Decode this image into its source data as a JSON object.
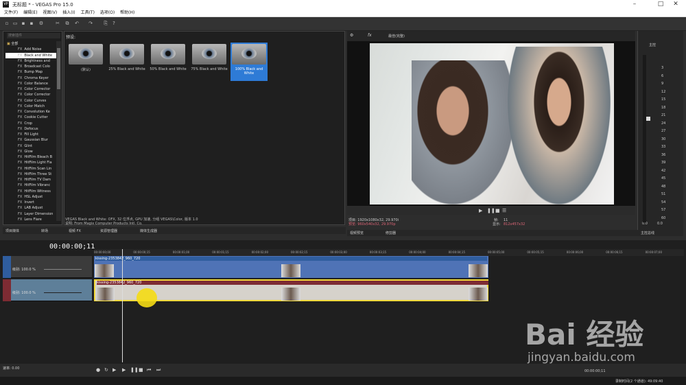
{
  "window": {
    "title": "无标题 * - VEGAS Pro 15.0",
    "app_icon": "VP"
  },
  "menu": [
    "文件(F)",
    "编辑(E)",
    "视图(V)",
    "插入(I)",
    "工具(T)",
    "选项(O)",
    "帮助(H)"
  ],
  "fx": {
    "search_placeholder": "搜索插件",
    "tree_root": "全部",
    "items": [
      "Add Noise",
      "Black and White",
      "Brightness and",
      "Broadcast Colo",
      "Bump Map",
      "Chroma Keyer",
      "Color Balance",
      "Color Corrector",
      "Color Corrector",
      "Color Curves",
      "Color Match",
      "Convolution Ke",
      "Cookie Cutter",
      "Crop",
      "Defocus",
      "Fill Light",
      "Gaussian Blur",
      "Glint",
      "Glow",
      "HitFilm Bleach B",
      "HitFilm Light Fla",
      "HitFilm Scan Lin",
      "HitFilm Three St",
      "HitFilm TV Dam",
      "HitFilm Vibranc",
      "HitFilm Witness",
      "HSL Adjust",
      "Invert",
      "LAB Adjust",
      "Layer Dimension",
      "Lens Flare"
    ],
    "selected_index": 1,
    "fx_tag": "FX"
  },
  "presets": {
    "label": "预设:",
    "items": [
      "(默认)",
      "25% Black and White",
      "50% Black and White",
      "75% Black and White",
      "100% Black and White"
    ],
    "selected_index": 4,
    "desc1": "VEGAS Black and White: OFX, 32 位浮点, GPU 加速, 分组 VEGAS\\Color, 版本 1.0",
    "desc2": "说明: From Magix Computer Products Intl. Co."
  },
  "bottom_tabs": [
    "项目媒体",
    "转场",
    "视频 FX",
    "资源管理器",
    "媒体生成器"
  ],
  "preview": {
    "quality": "最佳(完整)",
    "project_info": "项目: 1920x1080x32, 29.970i",
    "preview_info": "预览: 960x540x32, 29.970p",
    "frame_label": "帧:",
    "frame_value": "11",
    "display_label": "显示:",
    "display_value": "812x457x32",
    "tabs": [
      "视频预览",
      "修剪器"
    ]
  },
  "master": {
    "label": "主控",
    "tab": "主控总线",
    "ticks": [
      "3",
      "6",
      "9",
      "12",
      "15",
      "18",
      "21",
      "24",
      "27",
      "30",
      "33",
      "36",
      "39",
      "42",
      "45",
      "48",
      "51",
      "54",
      "57",
      "60"
    ],
    "left_value": "0.0",
    "right_value": "0.0"
  },
  "timeline": {
    "timecode": "00:00:00;11",
    "ruler": [
      "00:00:00;00",
      "00:00:00;15",
      "00:00:01;00",
      "00:00:01;15",
      "00:00:02;00",
      "00:00:02;15",
      "00:00:03;00",
      "00:00:03;15",
      "00:00:04;00",
      "00:00:04;15",
      "00:00:05;00",
      "00:00:05;15",
      "00:00:06;00",
      "00:00:06;15",
      "00:00:07;00"
    ],
    "tracks": [
      {
        "level": "级别: 100.0 %",
        "clip": "kissing-2353842_960_720"
      },
      {
        "level": "级别: 100.0 %",
        "clip": "kissing-2353842_960_720"
      }
    ]
  },
  "transport": {
    "rate": "速率: 0.00",
    "time": "00:00:00;11"
  },
  "status": {
    "record": "录制时间(2 个通道): 49:09:40"
  },
  "watermark": {
    "brand": "Bai 经验",
    "url": "jingyan.baidu.com"
  }
}
